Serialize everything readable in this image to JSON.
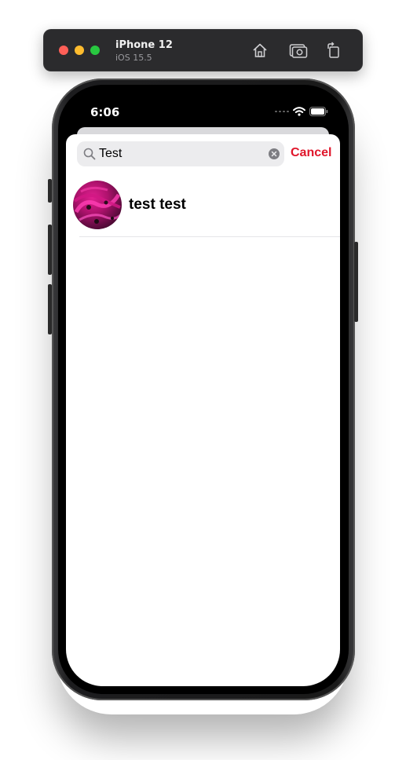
{
  "simulator": {
    "device_name": "iPhone 12",
    "os_version": "iOS 15.5",
    "icons": [
      "home-icon",
      "screenshot-icon",
      "rotate-icon"
    ]
  },
  "status_bar": {
    "time": "6:06"
  },
  "search": {
    "value": "Test",
    "cancel_label": "Cancel"
  },
  "results": [
    {
      "name": "test test",
      "avatar": "flower-photo"
    }
  ],
  "colors": {
    "accent": "#e0162b",
    "search_field_bg": "#ececee"
  }
}
